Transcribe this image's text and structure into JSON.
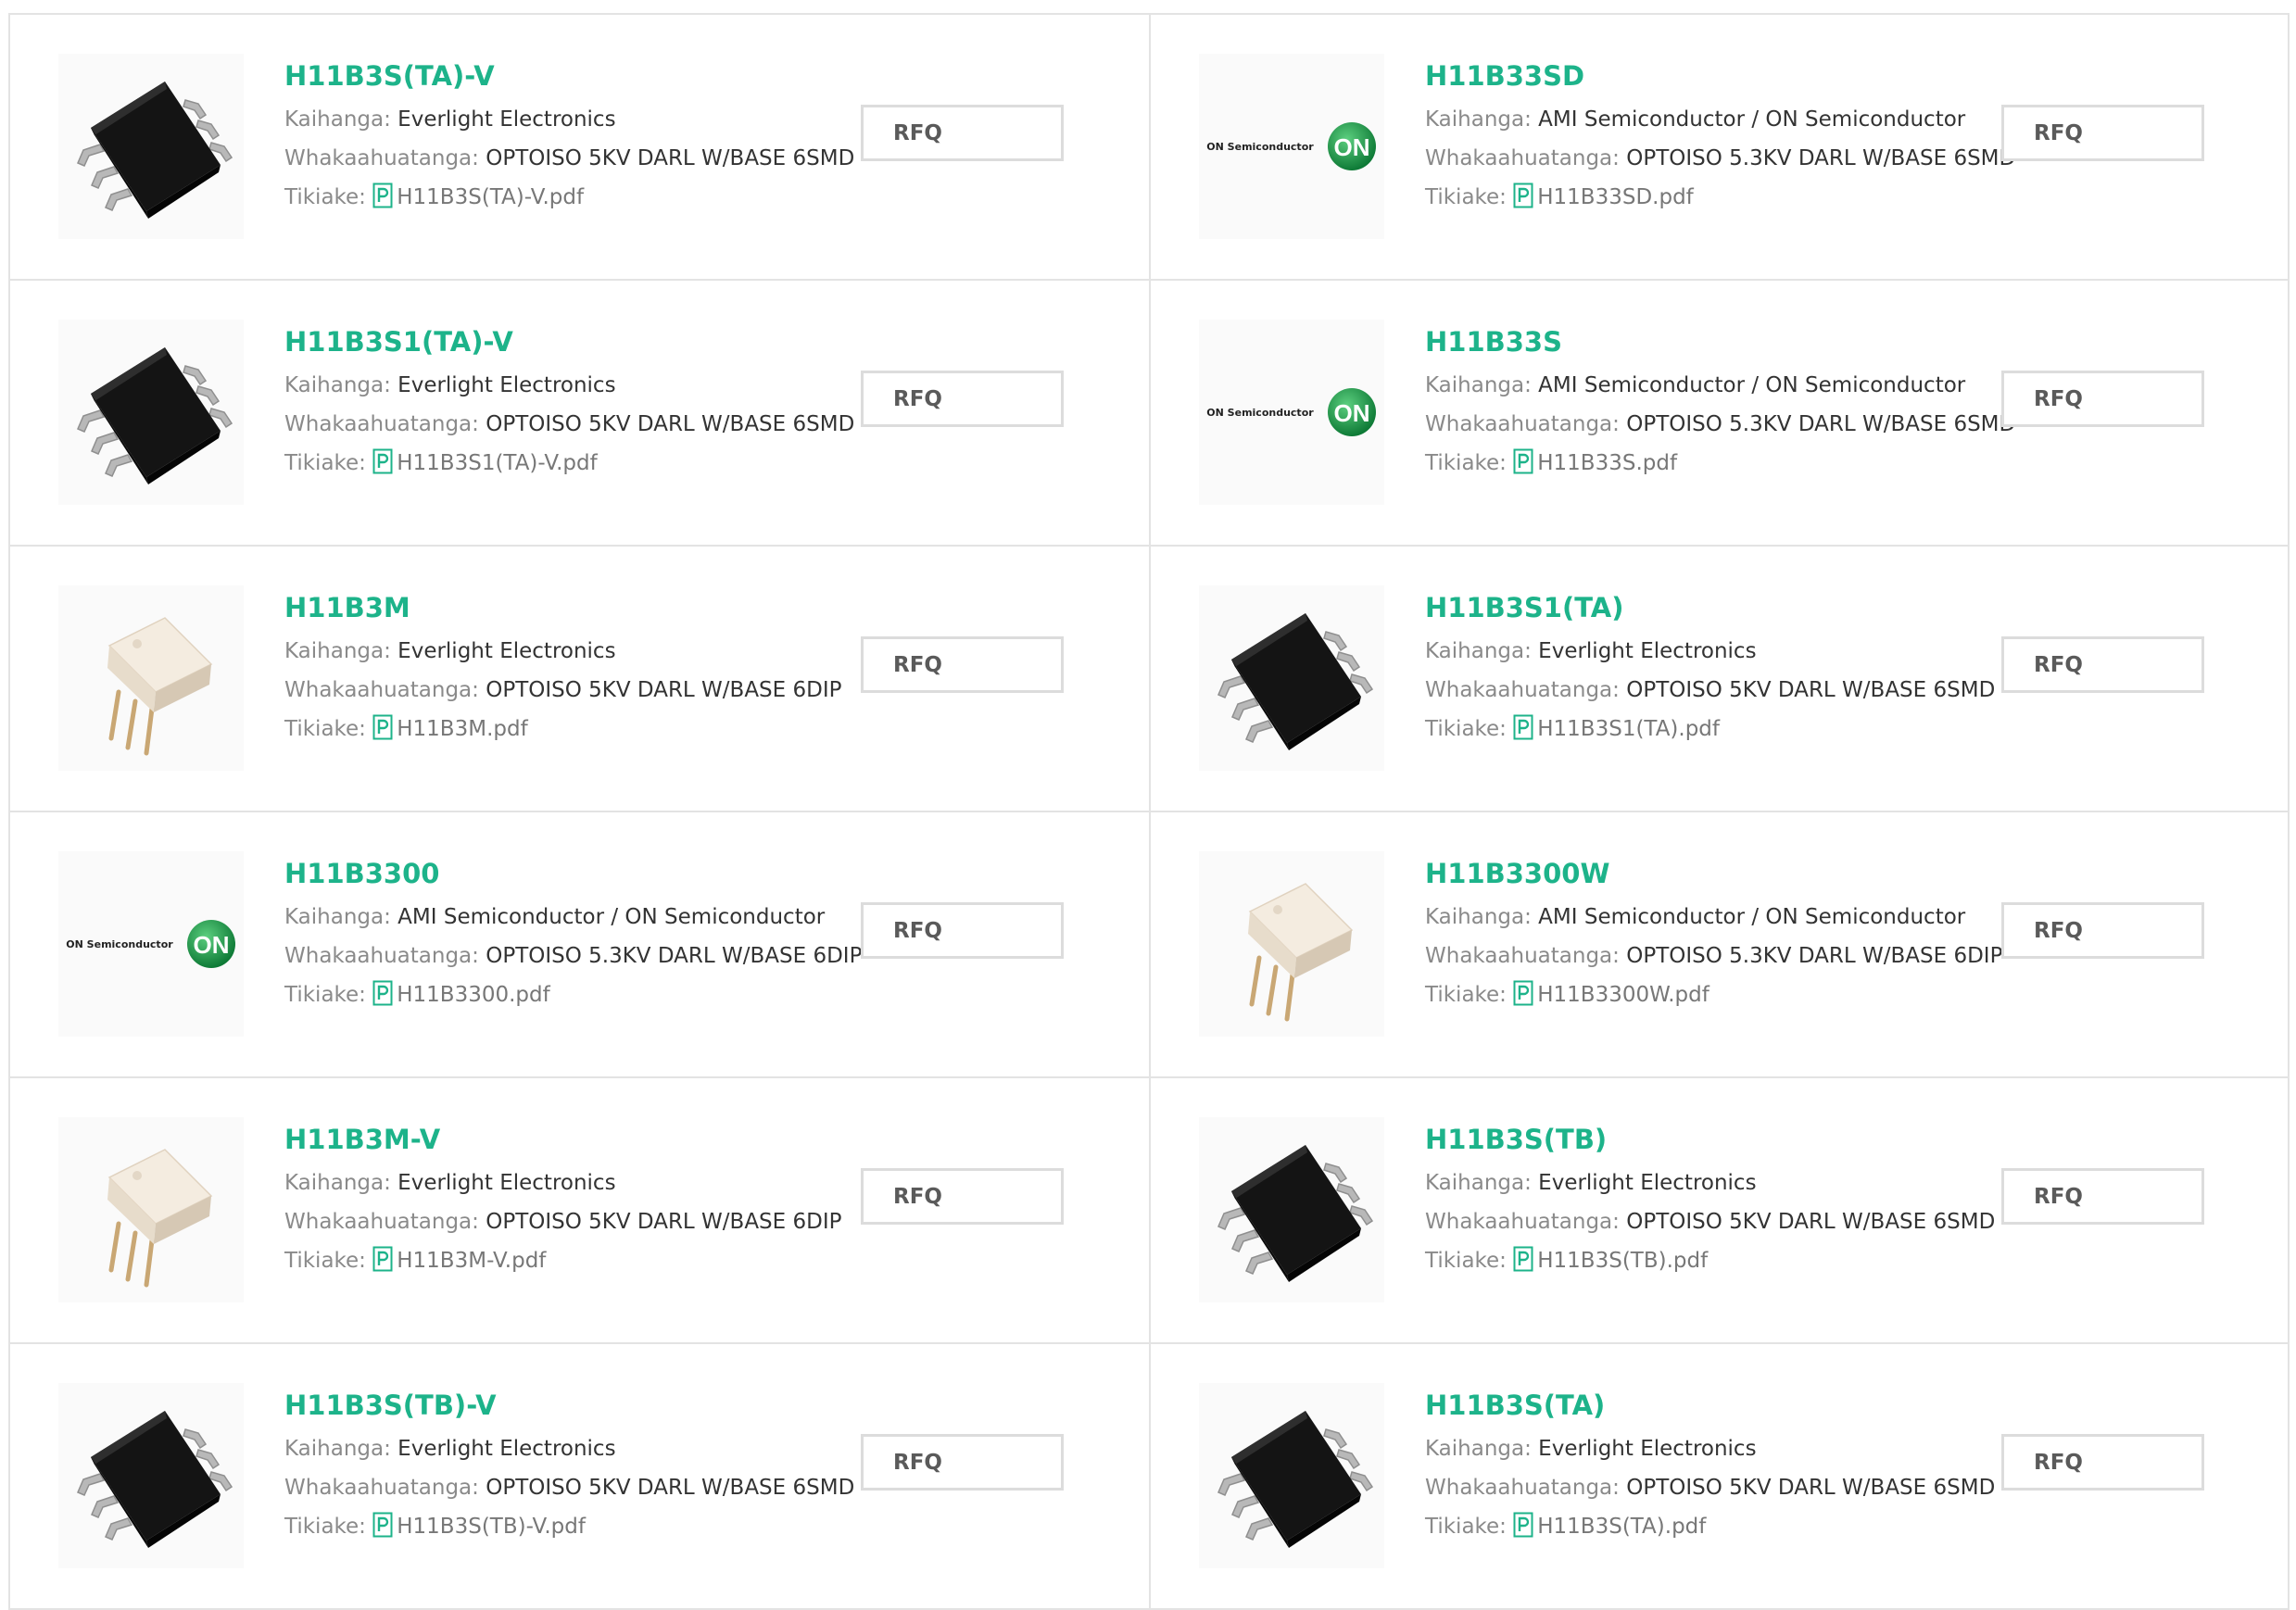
{
  "labels": {
    "manufacturer": "Kaihanga: ",
    "description": "Whakaahuatanga: ",
    "datasheet": "Tikiake: ",
    "rfq": "RFQ"
  },
  "on_logo_text": "ON Semiconductor",
  "products": [
    {
      "name": "H11B3S(TA)-V",
      "manufacturer": "Everlight Electronics",
      "description": "OPTOISO 5KV DARL W/BASE 6SMD",
      "pdf": "H11B3S(TA)-V.pdf",
      "image": "smd-chip-icon"
    },
    {
      "name": "H11B33SD",
      "manufacturer": "AMI Semiconductor / ON Semiconductor",
      "description": "OPTOISO 5.3KV DARL W/BASE 6SMD",
      "pdf": "H11B33SD.pdf",
      "image": "on-semiconductor-logo"
    },
    {
      "name": "H11B3S1(TA)-V",
      "manufacturer": "Everlight Electronics",
      "description": "OPTOISO 5KV DARL W/BASE 6SMD",
      "pdf": "H11B3S1(TA)-V.pdf",
      "image": "smd-chip-icon"
    },
    {
      "name": "H11B33S",
      "manufacturer": "AMI Semiconductor / ON Semiconductor",
      "description": "OPTOISO 5.3KV DARL W/BASE 6SMD",
      "pdf": "H11B33S.pdf",
      "image": "on-semiconductor-logo"
    },
    {
      "name": "H11B3M",
      "manufacturer": "Everlight Electronics",
      "description": "OPTOISO 5KV DARL W/BASE 6DIP",
      "pdf": "H11B3M.pdf",
      "image": "dip-chip-icon"
    },
    {
      "name": "H11B3S1(TA)",
      "manufacturer": "Everlight Electronics",
      "description": "OPTOISO 5KV DARL W/BASE 6SMD",
      "pdf": "H11B3S1(TA).pdf",
      "image": "smd-chip-icon"
    },
    {
      "name": "H11B3300",
      "manufacturer": "AMI Semiconductor / ON Semiconductor",
      "description": "OPTOISO 5.3KV DARL W/BASE 6DIP",
      "pdf": "H11B3300.pdf",
      "image": "on-semiconductor-logo"
    },
    {
      "name": "H11B3300W",
      "manufacturer": "AMI Semiconductor / ON Semiconductor",
      "description": "OPTOISO 5.3KV DARL W/BASE 6DIP",
      "pdf": "H11B3300W.pdf",
      "image": "dip-chip-icon"
    },
    {
      "name": "H11B3M-V",
      "manufacturer": "Everlight Electronics",
      "description": "OPTOISO 5KV DARL W/BASE 6DIP",
      "pdf": "H11B3M-V.pdf",
      "image": "dip-chip-icon"
    },
    {
      "name": "H11B3S(TB)",
      "manufacturer": "Everlight Electronics",
      "description": "OPTOISO 5KV DARL W/BASE 6SMD",
      "pdf": "H11B3S(TB).pdf",
      "image": "smd-chip-icon"
    },
    {
      "name": "H11B3S(TB)-V",
      "manufacturer": "Everlight Electronics",
      "description": "OPTOISO 5KV DARL W/BASE 6SMD",
      "pdf": "H11B3S(TB)-V.pdf",
      "image": "smd-chip-icon"
    },
    {
      "name": "H11B3S(TA)",
      "manufacturer": "Everlight Electronics",
      "description": "OPTOISO 5KV DARL W/BASE 6SMD",
      "pdf": "H11B3S(TA).pdf",
      "image": "smd-chip-icon"
    }
  ],
  "colors": {
    "product_name": "#1db38a",
    "on_logo": "#1e9a4a",
    "border": "#e3e3e3"
  }
}
